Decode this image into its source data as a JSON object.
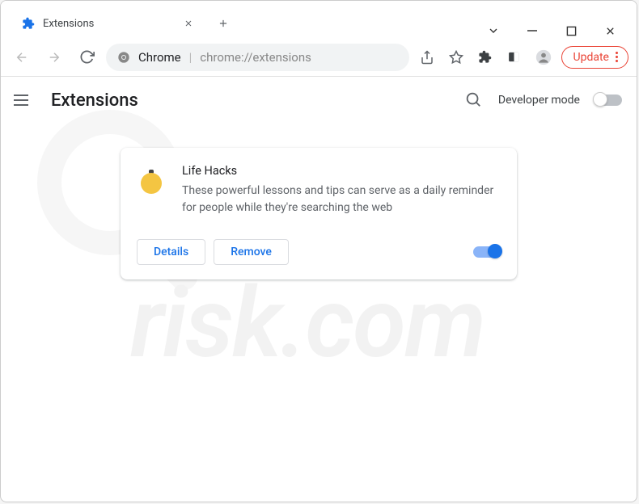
{
  "window": {
    "tab_title": "Extensions"
  },
  "omnibox": {
    "chrome_label": "Chrome",
    "url": "chrome://extensions"
  },
  "toolbar": {
    "update_label": "Update"
  },
  "ext_page": {
    "title": "Extensions",
    "dev_mode_label": "Developer mode"
  },
  "extension": {
    "name": "Life Hacks",
    "description": "These powerful lessons and tips can serve as a daily reminder for people while they're searching the web",
    "details_label": "Details",
    "remove_label": "Remove",
    "enabled": true
  },
  "watermark": {
    "text": "risk.com"
  }
}
